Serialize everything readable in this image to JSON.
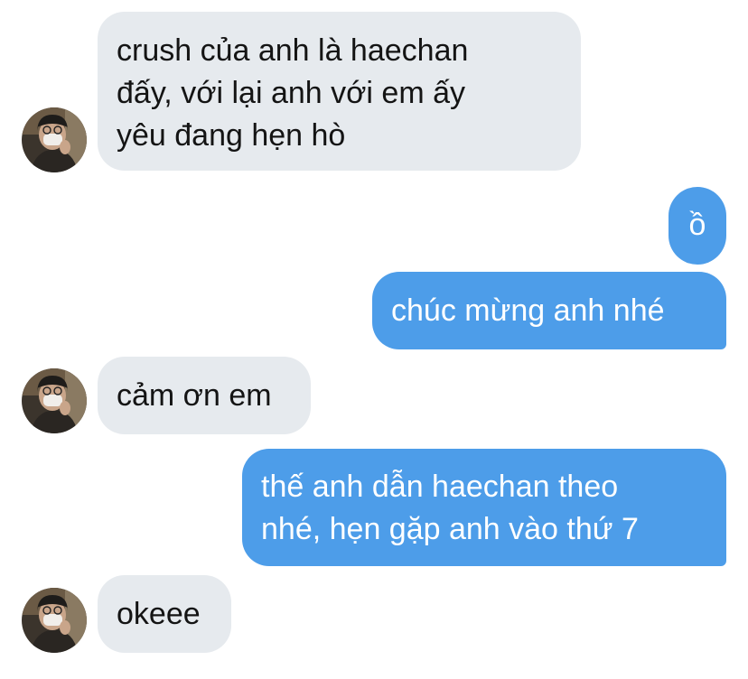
{
  "conversation": {
    "messages": [
      {
        "sender": "them",
        "text": "crush của anh là haechan\nđấy, với lại anh với em ấy\nyêu đang hẹn hò"
      },
      {
        "sender": "me",
        "text": "ồ"
      },
      {
        "sender": "me",
        "text": "chúc mừng anh nhé"
      },
      {
        "sender": "them",
        "text": "cảm ơn em"
      },
      {
        "sender": "me",
        "text": "thế anh dẫn haechan theo\nnhé, hẹn gặp anh vào thứ 7"
      },
      {
        "sender": "them",
        "text": "okeee"
      }
    ]
  },
  "colors": {
    "incoming_bubble": "#e6eaee",
    "outgoing_bubble": "#4d9de9",
    "incoming_text": "#141414",
    "outgoing_text": "#ffffff"
  },
  "icons": {
    "avatar": "contact-avatar-photo"
  }
}
